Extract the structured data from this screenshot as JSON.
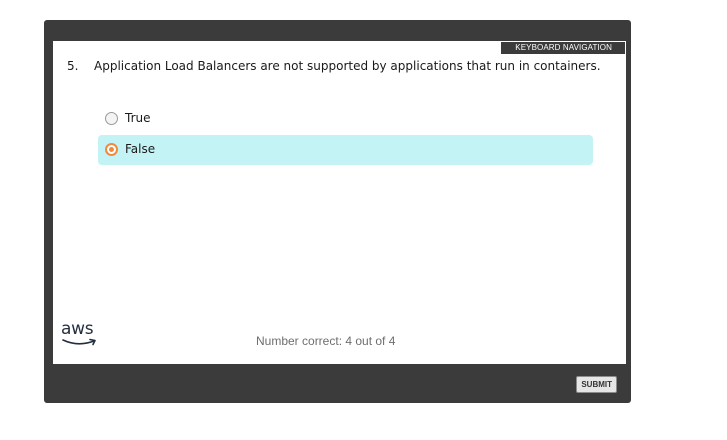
{
  "header": {
    "keyboard_navigation_label": "KEYBOARD NAVIGATION"
  },
  "question": {
    "number": "5.",
    "text": "Application Load Balancers are not supported by applications that run in containers."
  },
  "options": [
    {
      "label": "True",
      "selected": false
    },
    {
      "label": "False",
      "selected": true
    }
  ],
  "logo": {
    "text": "aws",
    "icon": "aws-smile-logo"
  },
  "footer": {
    "score_text": "Number correct: 4 out of 4",
    "submit_label": "SUBMIT"
  },
  "colors": {
    "frame": "#3b3b3b",
    "selected_background": "#c4f3f6",
    "radio_accent": "#f28a3c"
  }
}
